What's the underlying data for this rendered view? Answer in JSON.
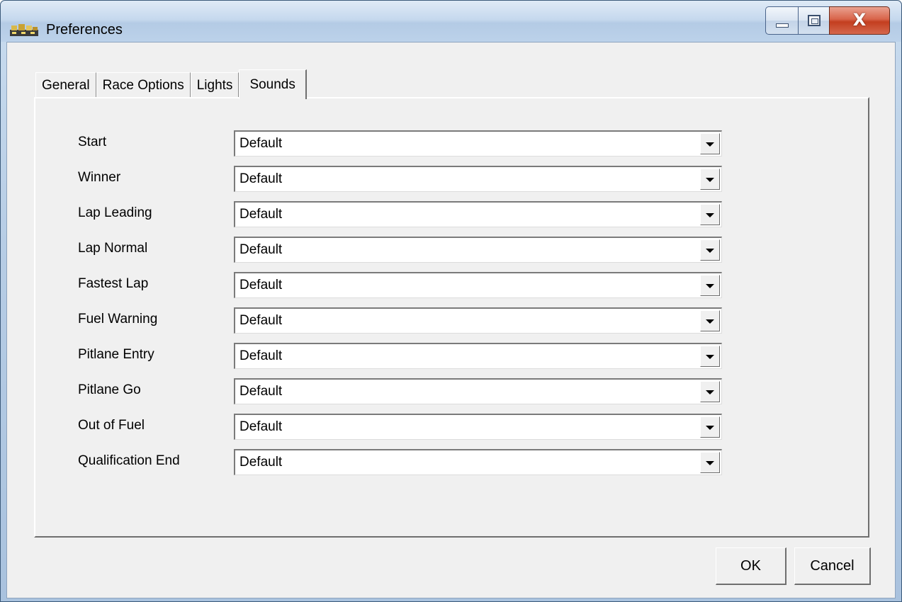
{
  "window": {
    "title": "Preferences",
    "icon": "race-track-icon",
    "controls": {
      "close_glyph": "X"
    }
  },
  "tabs": [
    {
      "label": "General"
    },
    {
      "label": "Race Options"
    },
    {
      "label": "Lights"
    },
    {
      "label": "Sounds",
      "active": true
    }
  ],
  "sounds": [
    {
      "label": "Start",
      "value": "Default"
    },
    {
      "label": "Winner",
      "value": "Default"
    },
    {
      "label": "Lap Leading",
      "value": "Default"
    },
    {
      "label": "Lap Normal",
      "value": "Default"
    },
    {
      "label": "Fastest Lap",
      "value": "Default"
    },
    {
      "label": "Fuel Warning",
      "value": "Default"
    },
    {
      "label": "Pitlane Entry",
      "value": "Default"
    },
    {
      "label": "Pitlane Go",
      "value": "Default"
    },
    {
      "label": "Out of Fuel",
      "value": "Default"
    },
    {
      "label": "Qualification End",
      "value": "Default"
    }
  ],
  "buttons": {
    "ok": "OK",
    "cancel": "Cancel"
  }
}
